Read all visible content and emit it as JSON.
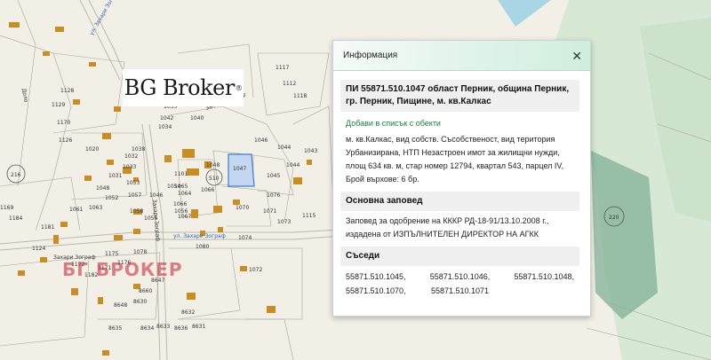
{
  "logo": {
    "text": "BG Broker",
    "mark": "®"
  },
  "watermark": "БГ БРОКЕР",
  "map": {
    "street_labels": [
      "ул. Захари Зограф",
      "Захари Зограф",
      "ул. Захари Зограф",
      "Захари Зограф",
      "Доло",
      "Захари Зограф"
    ],
    "parcel_numbers": [
      "1047",
      "1045",
      "1048",
      "1046",
      "1044",
      "1043",
      "1117",
      "1118",
      "1115",
      "1064",
      "1101",
      "1073",
      "1070",
      "1074",
      "1071",
      "1072",
      "1066",
      "1065",
      "1067",
      "1080",
      "1041",
      "1042",
      "1035",
      "1034",
      "1037",
      "1040",
      "1032",
      "1033",
      "1031",
      "1038",
      "1053",
      "1048",
      "1052",
      "1057",
      "1058",
      "1055",
      "1061",
      "1063",
      "1054",
      "1056",
      "1078",
      "1176",
      "1175",
      "1171",
      "1172",
      "1182",
      "1181",
      "1184",
      "1169",
      "1170",
      "1129",
      "1126",
      "1128",
      "1124",
      "8647",
      "8660",
      "8630",
      "8648",
      "8632",
      "8631",
      "8636",
      "8633",
      "8634",
      "8635",
      "1044",
      "1076",
      "1066",
      "1020",
      "1046",
      "1112"
    ],
    "circle_labels": [
      "216",
      "510",
      "220"
    ],
    "colors": {
      "background": "#f1efe6",
      "lines": "#aaa59a",
      "buildings": "#c98e22",
      "selected": "#c4d6f0",
      "selected_border": "#3a7fd5",
      "forest": "#cfe3cf",
      "forest_dark": "#6ea58a",
      "water": "#a9d6e4",
      "road_label": "#2a63b5"
    }
  },
  "panel": {
    "title": "Информация",
    "close_icon": "close-icon",
    "heading": "ПИ 55871.510.1047 област Перник, община Перник, гр. Перник, Пищине, м. кв.Калкас",
    "add_link": "Добави в списък с обекти",
    "description": "м. кв.Калкас, вид собств. Съсобственост, вид територия Урбанизирана, НТП Незастроен имот за жилищни нужди, площ 634 кв. м, стар номер 12794, квартал 543, парцел IV, Брой върхове: 6 бр.",
    "order_heading": "Основна заповед",
    "order_text": "Заповед за одобрение на КККР РД-18-91/13.10.2008 г., издадена от ИЗПЪЛНИТЕЛЕН ДИРЕКТОР НА АГКК",
    "neighbors_heading": "Съседи",
    "neighbors": [
      "55871.510.1045,",
      "55871.510.1046,",
      "55871.510.1048,",
      "55871.510.1070,",
      "55871.510.1071",
      ""
    ]
  }
}
